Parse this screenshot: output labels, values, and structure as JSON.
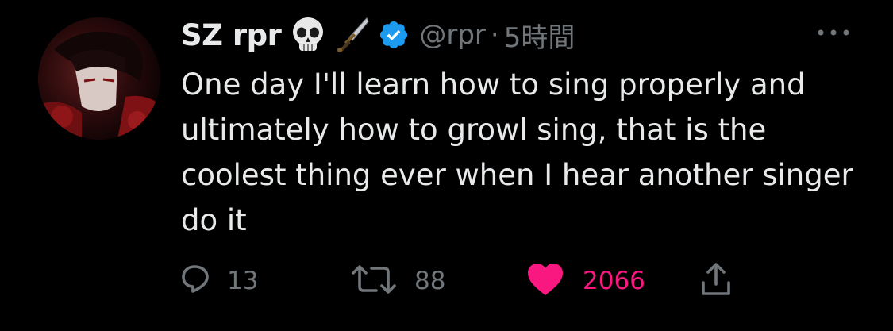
{
  "tweet": {
    "author": {
      "display_name": "SZ rpr",
      "emojis": [
        "skull-emoji",
        "dagger-emoji"
      ],
      "verified": true,
      "handle": "@rpr"
    },
    "separator": "·",
    "timestamp": "5時間",
    "text": "One day I'll learn how to sing properly and ultimately how to growl sing, that is the coolest thing ever when I hear another singer do it"
  },
  "actions": {
    "reply_count": "13",
    "retweet_count": "88",
    "like_count": "2066",
    "liked": true
  },
  "icons": {
    "reply": "reply-icon",
    "retweet": "retweet-icon",
    "like": "heart-icon",
    "share": "share-icon",
    "more": "more-icon",
    "verified": "verified-badge-icon"
  },
  "colors": {
    "background": "#000000",
    "text_primary": "#e7e9ea",
    "text_secondary": "#71767b",
    "verified_blue": "#1d9bf0",
    "like_pink": "#f91880"
  }
}
